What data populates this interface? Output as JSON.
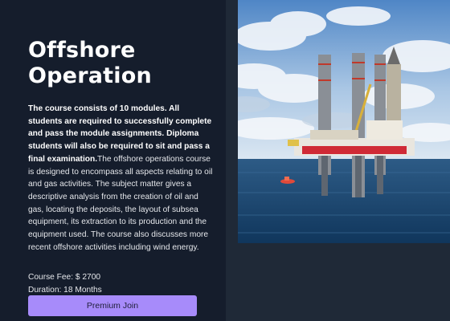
{
  "course": {
    "title": "Offshore Operation",
    "description_bold": "The course consists of 10 modules. All students are required to successfully complete and pass the module assignments. Diploma students will also be required to sit and pass a final examination.",
    "description_rest": "The offshore operations course is designed to encompass all aspects relating to oil and gas activities. The subject matter gives a descriptive analysis from the creation of oil and gas, locating the deposits, the layout of subsea equipment, its extraction to its production and the equipment used. The course also discusses more recent offshore activities including wind energy.",
    "fee": "Course Fee: $ 2700",
    "duration": "Duration: 18 Months",
    "join_label": "Premium Join"
  },
  "colors": {
    "panel_bg": "#151d2c",
    "page_bg": "#1f2937",
    "accent": "#a78bfa"
  },
  "image": {
    "subject": "offshore-oil-rig-photo"
  }
}
